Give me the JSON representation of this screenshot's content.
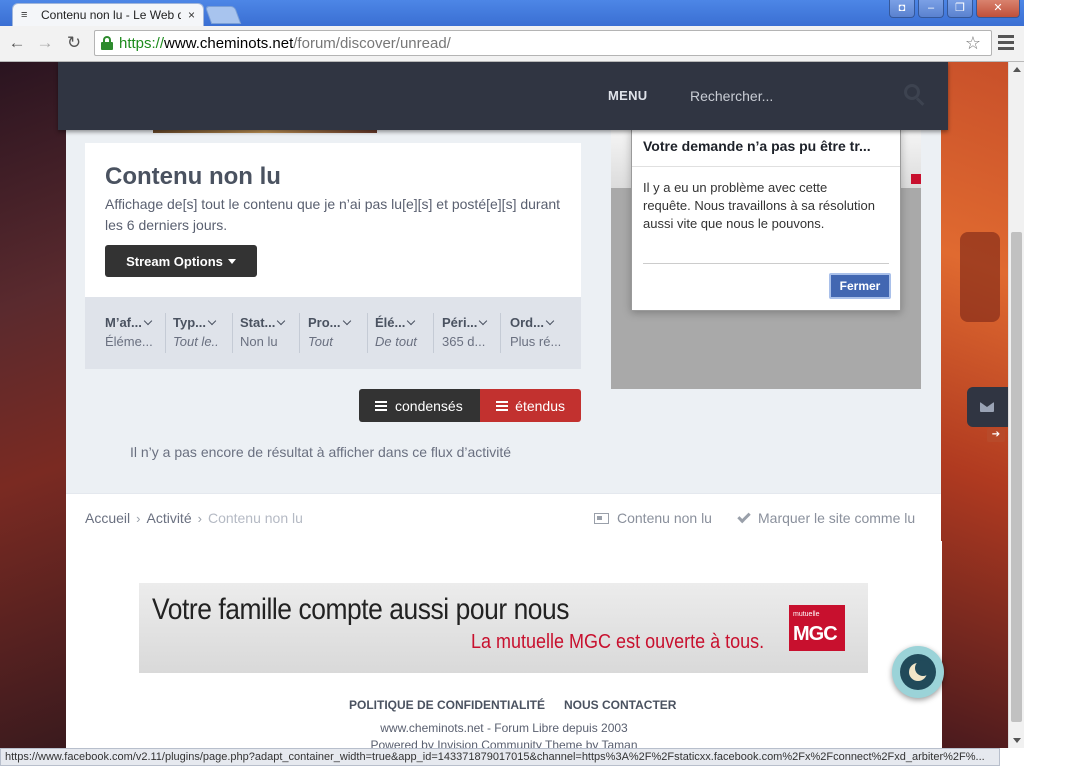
{
  "browser": {
    "tab_title": "Contenu non lu - Le Web des",
    "tab_close": "×",
    "url_scheme": "https://",
    "url_host": "www.cheminots.net",
    "url_path": "/forum/discover/unread/",
    "status_url": "https://www.facebook.com/v2.11/plugins/page.php?adapt_container_width=true&app_id=143371879017015&channel=https%3A%2F%2Fstaticxx.facebook.com%2Fx%2Fconnect%2Fxd_arbiter%2F%..."
  },
  "navbar": {
    "menu_label": "MENU",
    "search_placeholder": "Rechercher..."
  },
  "main": {
    "title": "Contenu non lu",
    "description": "Affichage de[s] tout le contenu que je n’ai pas lu[e][s] et posté[e][s] durant les 6 derniers jours.",
    "stream_options": "Stream Options",
    "filters": [
      {
        "label": "M’af...",
        "value": "Éléme...",
        "italic": false
      },
      {
        "label": "Typ...",
        "value": "Tout le..",
        "italic": true
      },
      {
        "label": "Stat...",
        "value": "Non lu",
        "italic": false
      },
      {
        "label": "Pro...",
        "value": "Tout",
        "italic": true
      },
      {
        "label": "Élé...",
        "value": "De tout",
        "italic": true
      },
      {
        "label": "Péri...",
        "value": "365 d...",
        "italic": false
      },
      {
        "label": "Ord...",
        "value": "Plus ré...",
        "italic": false
      }
    ],
    "view_condensed": "condensés",
    "view_expanded": "étendus",
    "empty_message": "Il n’y a pas encore de résultat à afficher dans ce flux d’activité"
  },
  "dialog": {
    "title": "Votre demande n’a pas pu être tr...",
    "body": "Il y a eu un problème avec cette requête. Nous travaillons à sa résolution aussi vite que nous le pouvons.",
    "close_button": "Fermer"
  },
  "breadcrumb": {
    "items": [
      "Accueil",
      "Activité",
      "Contenu non lu"
    ],
    "sep": "›",
    "unread_link": "Contenu non lu",
    "mark_read": "Marquer le site comme lu"
  },
  "ad": {
    "headline": "Votre famille compte aussi pour nous",
    "subline": "La mutuelle MGC est ouverte à tous.",
    "logo_small": "mutuelle",
    "logo_main": "MGC"
  },
  "footer": {
    "privacy": "POLITIQUE DE CONFIDENTIALITÉ",
    "contact": "NOUS CONTACTER",
    "line1": "www.cheminots.net - Forum Libre depuis 2003",
    "line2": "Powered by Invision Community  Theme by Taman"
  }
}
